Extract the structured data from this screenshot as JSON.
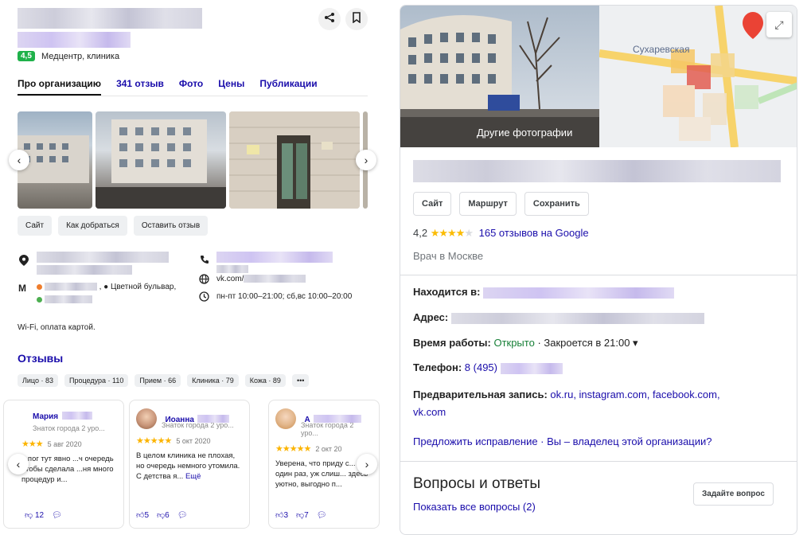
{
  "left": {
    "rating": "4,5",
    "category": "Медцентр, клиника",
    "tabs": [
      "Про организацию",
      "341 отзыв",
      "Фото",
      "Цены",
      "Публикации"
    ],
    "actions": [
      "Сайт",
      "Как добраться",
      "Оставить отзыв"
    ],
    "metro_suffix": ", ● Цветной бульвар,",
    "website": "vk.com/",
    "hours": "пн-пт 10:00–21:00; сб,вс 10:00–20:00",
    "amenities": "Wi-Fi, оплата картой.",
    "reviews_title": "Отзывы",
    "chips": [
      "Лицо · 83",
      "Процедура · 110",
      "Прием · 66",
      "Клиника · 79",
      "Кожа · 89",
      "•••"
    ],
    "reviews": [
      {
        "name": "Мария",
        "sub": "Знаток города 2 уро...",
        "date": "5 авг 2020",
        "text": "...пог тут явно ...ч очередь чтобы сделала ...ня много процедур и...",
        "more": "",
        "likes": "12",
        "dislikes": "",
        "stars": "★★★"
      },
      {
        "name": "Иоанна",
        "sub": "Знаток города 2 уро...",
        "date": "5 окт 2020",
        "text": "В целом клиника не плохая, но очередь немного утомила. С детства я...",
        "more": "Ещё",
        "likes": "5",
        "dislikes": "6",
        "stars": "★★★★★"
      },
      {
        "name": "А",
        "sub": "Знаток города 2 уро...",
        "date": "2 окт 20",
        "text": "Уверена, что приду с... не один раз, уж слиш... здесь уютно, выгодно п...",
        "more": "",
        "likes": "3",
        "dislikes": "7",
        "stars": "★★★★★"
      }
    ]
  },
  "right": {
    "photo_label": "Другие фотографии",
    "map_label": "Сухаревская",
    "actions": [
      "Сайт",
      "Маршрут",
      "Сохранить"
    ],
    "rating": "4,2",
    "stars_filled": "★★★★",
    "stars_empty": "★",
    "reviews_link": "165 отзывов на Google",
    "category": "Врач в Москве",
    "located_label": "Находится в:",
    "address_label": "Адрес:",
    "hours_label": "Время работы:",
    "hours_status": "Открыто",
    "hours_close": "· Закроется в 21:00 ▾",
    "phone_label": "Телефон:",
    "phone_value": "8 (495)",
    "booking_label": "Предварительная запись:",
    "booking_links_line1": "ok.ru, instagram.com, facebook.com,",
    "booking_links_line2": "vk.com",
    "suggest": "Предложить исправление · Вы – владелец этой организации?",
    "qa_title": "Вопросы и ответы",
    "qa_link": "Показать все вопросы (2)",
    "ask_button": "Задайте вопрос"
  }
}
